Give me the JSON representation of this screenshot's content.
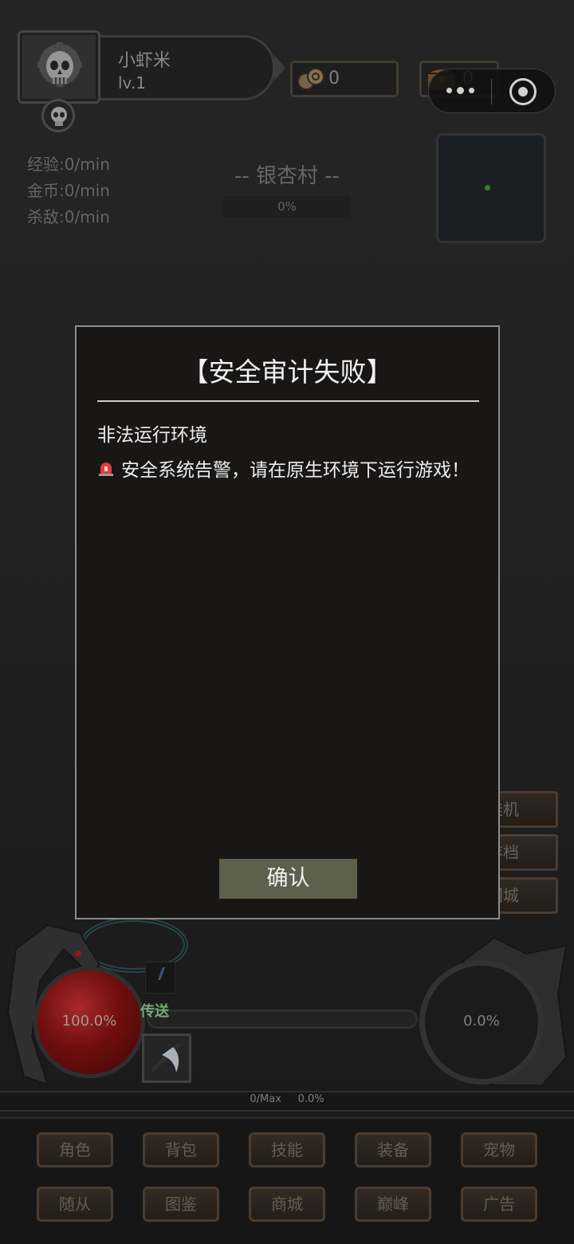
{
  "player": {
    "name": "小虾米",
    "level": "lv.1"
  },
  "resources": {
    "gold": "0",
    "chest": "0"
  },
  "stats": {
    "exp": "经验:0/min",
    "gold": "金币:0/min",
    "kills": "杀敌:0/min"
  },
  "map": {
    "name": "-- 银杏村 --",
    "progress": "0%"
  },
  "side_menu": [
    "挂机",
    "存档",
    "回城"
  ],
  "hud": {
    "hp": "100.0%",
    "mp": "0.0%",
    "skill_label": "传送",
    "exp_text": "0/Max     0.0%"
  },
  "bottom_menu": {
    "row1": [
      "角色",
      "背包",
      "技能",
      "装备",
      "宠物"
    ],
    "row2": [
      "随从",
      "图鉴",
      "商城",
      "巅峰",
      "广告"
    ]
  },
  "dialog": {
    "title": "【安全审计失败】",
    "line1": "非法运行环境",
    "line2": "安全系统告警，请在原生环境下运行游戏！",
    "confirm": "确认"
  },
  "icons": {
    "avatar": "skull-gear-icon",
    "badge": "skull-icon",
    "gold": "coins-icon",
    "chest": "treasure-chest-icon",
    "alert": "siren-icon",
    "skill": "scythe-icon"
  },
  "colors": {
    "accent_hp": "#8a1212",
    "confirm_bg": "#5c604d",
    "minimap_dot": "#3aa23a"
  }
}
